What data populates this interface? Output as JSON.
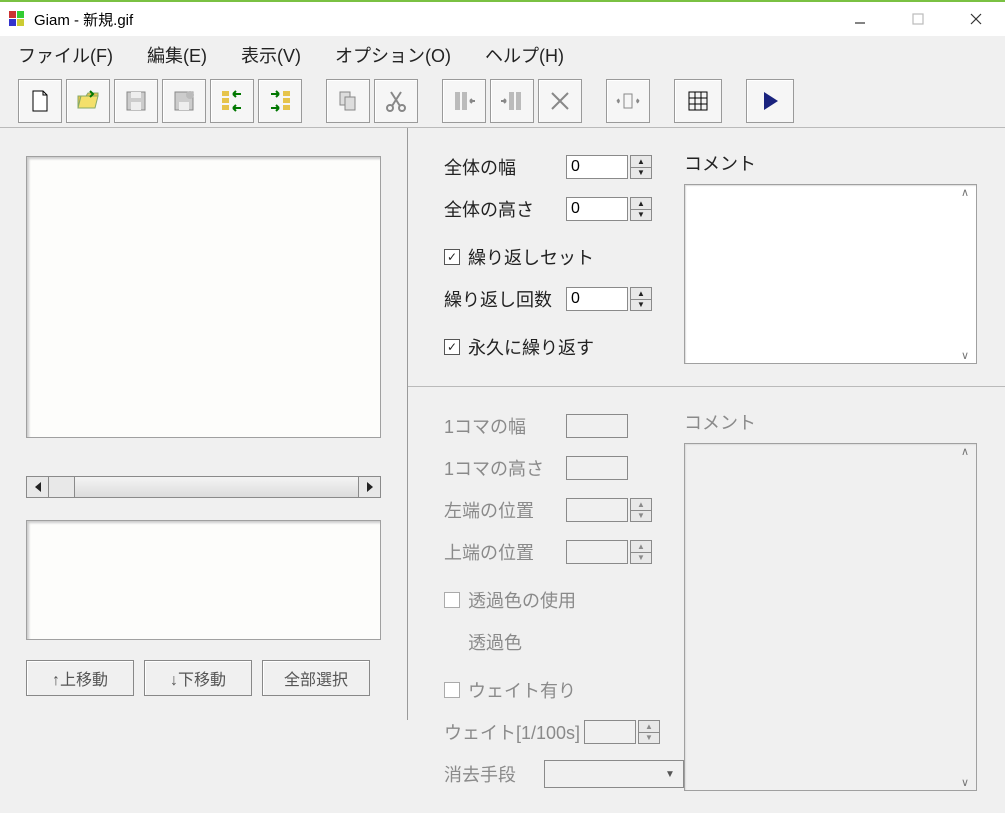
{
  "title": "Giam - 新規.gif",
  "menu": {
    "file": "ファイル(F)",
    "edit": "編集(E)",
    "view": "表示(V)",
    "option": "オプション(O)",
    "help": "ヘルプ(H)"
  },
  "toolbar_icons": {
    "new": "new-file-icon",
    "open": "open-folder-icon",
    "save": "save-icon",
    "save_as": "save-as-icon",
    "import": "import-frames-icon",
    "export": "export-frames-icon",
    "copy": "copy-icon",
    "cut": "cut-icon",
    "shift_left": "shift-left-icon",
    "shift_right": "shift-right-icon",
    "delete": "delete-icon",
    "resize": "resize-icon",
    "grid": "grid-icon",
    "play": "play-icon"
  },
  "left": {
    "move_up": "↑上移動",
    "move_down": "↓下移動",
    "select_all": "全部選択"
  },
  "global": {
    "width_label": "全体の幅",
    "width_value": "0",
    "height_label": "全体の高さ",
    "height_value": "0",
    "loop_set_label": "繰り返しセット",
    "loop_set_checked": true,
    "loop_count_label": "繰り返し回数",
    "loop_count_value": "0",
    "loop_forever_label": "永久に繰り返す",
    "loop_forever_checked": true,
    "comment_label": "コメント",
    "comment_value": ""
  },
  "frame": {
    "width_label": "1コマの幅",
    "width_value": "",
    "height_label": "1コマの高さ",
    "height_value": "",
    "left_label": "左端の位置",
    "left_value": "",
    "top_label": "上端の位置",
    "top_value": "",
    "use_trans_label": "透過色の使用",
    "use_trans_checked": false,
    "trans_color_label": "透過色",
    "wait_on_label": "ウェイト有り",
    "wait_on_checked": false,
    "wait_label": "ウェイト[1/100s]",
    "wait_value": "",
    "disposal_label": "消去手段",
    "disposal_value": "",
    "comment_label": "コメント",
    "comment_value": ""
  }
}
